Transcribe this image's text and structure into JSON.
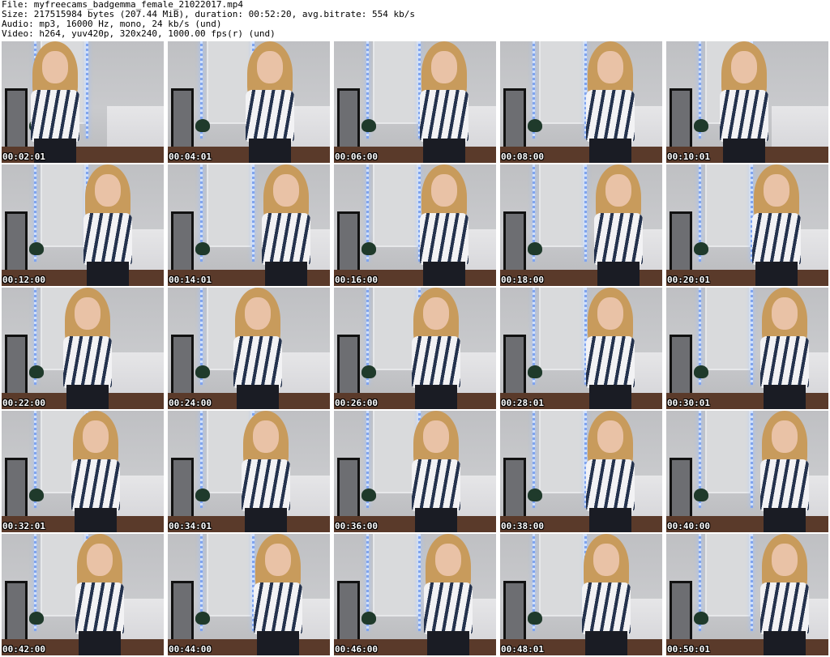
{
  "header": {
    "file": "File: myfreecams_badgemma_female_21022017.mp4",
    "size": "Size: 217515984 bytes (207.44 MiB), duration: 00:52:20, avg.bitrate: 554 kb/s",
    "audio": "Audio: mp3, 16000 Hz, mono, 24 kb/s (und)",
    "video": "Video: h264, yuv420p, 320x240, 1000.00 fps(r) (und)"
  },
  "thumbnails": [
    "00:02:01",
    "00:04:01",
    "00:06:00",
    "00:08:00",
    "00:10:01",
    "00:12:00",
    "00:14:01",
    "00:16:00",
    "00:18:00",
    "00:20:01",
    "00:22:00",
    "00:24:00",
    "00:26:00",
    "00:28:01",
    "00:30:01",
    "00:32:01",
    "00:34:01",
    "00:36:00",
    "00:38:00",
    "00:40:00",
    "00:42:00",
    "00:44:00",
    "00:46:00",
    "00:48:01",
    "00:50:01"
  ],
  "colors": {
    "background": "#ffffff",
    "text": "#000000",
    "timestamp": "#ffffff",
    "wall": "#c3c4c6",
    "lights": "#7fa4ef",
    "hair": "#c89b5c",
    "top_stripes": "#24324d"
  }
}
